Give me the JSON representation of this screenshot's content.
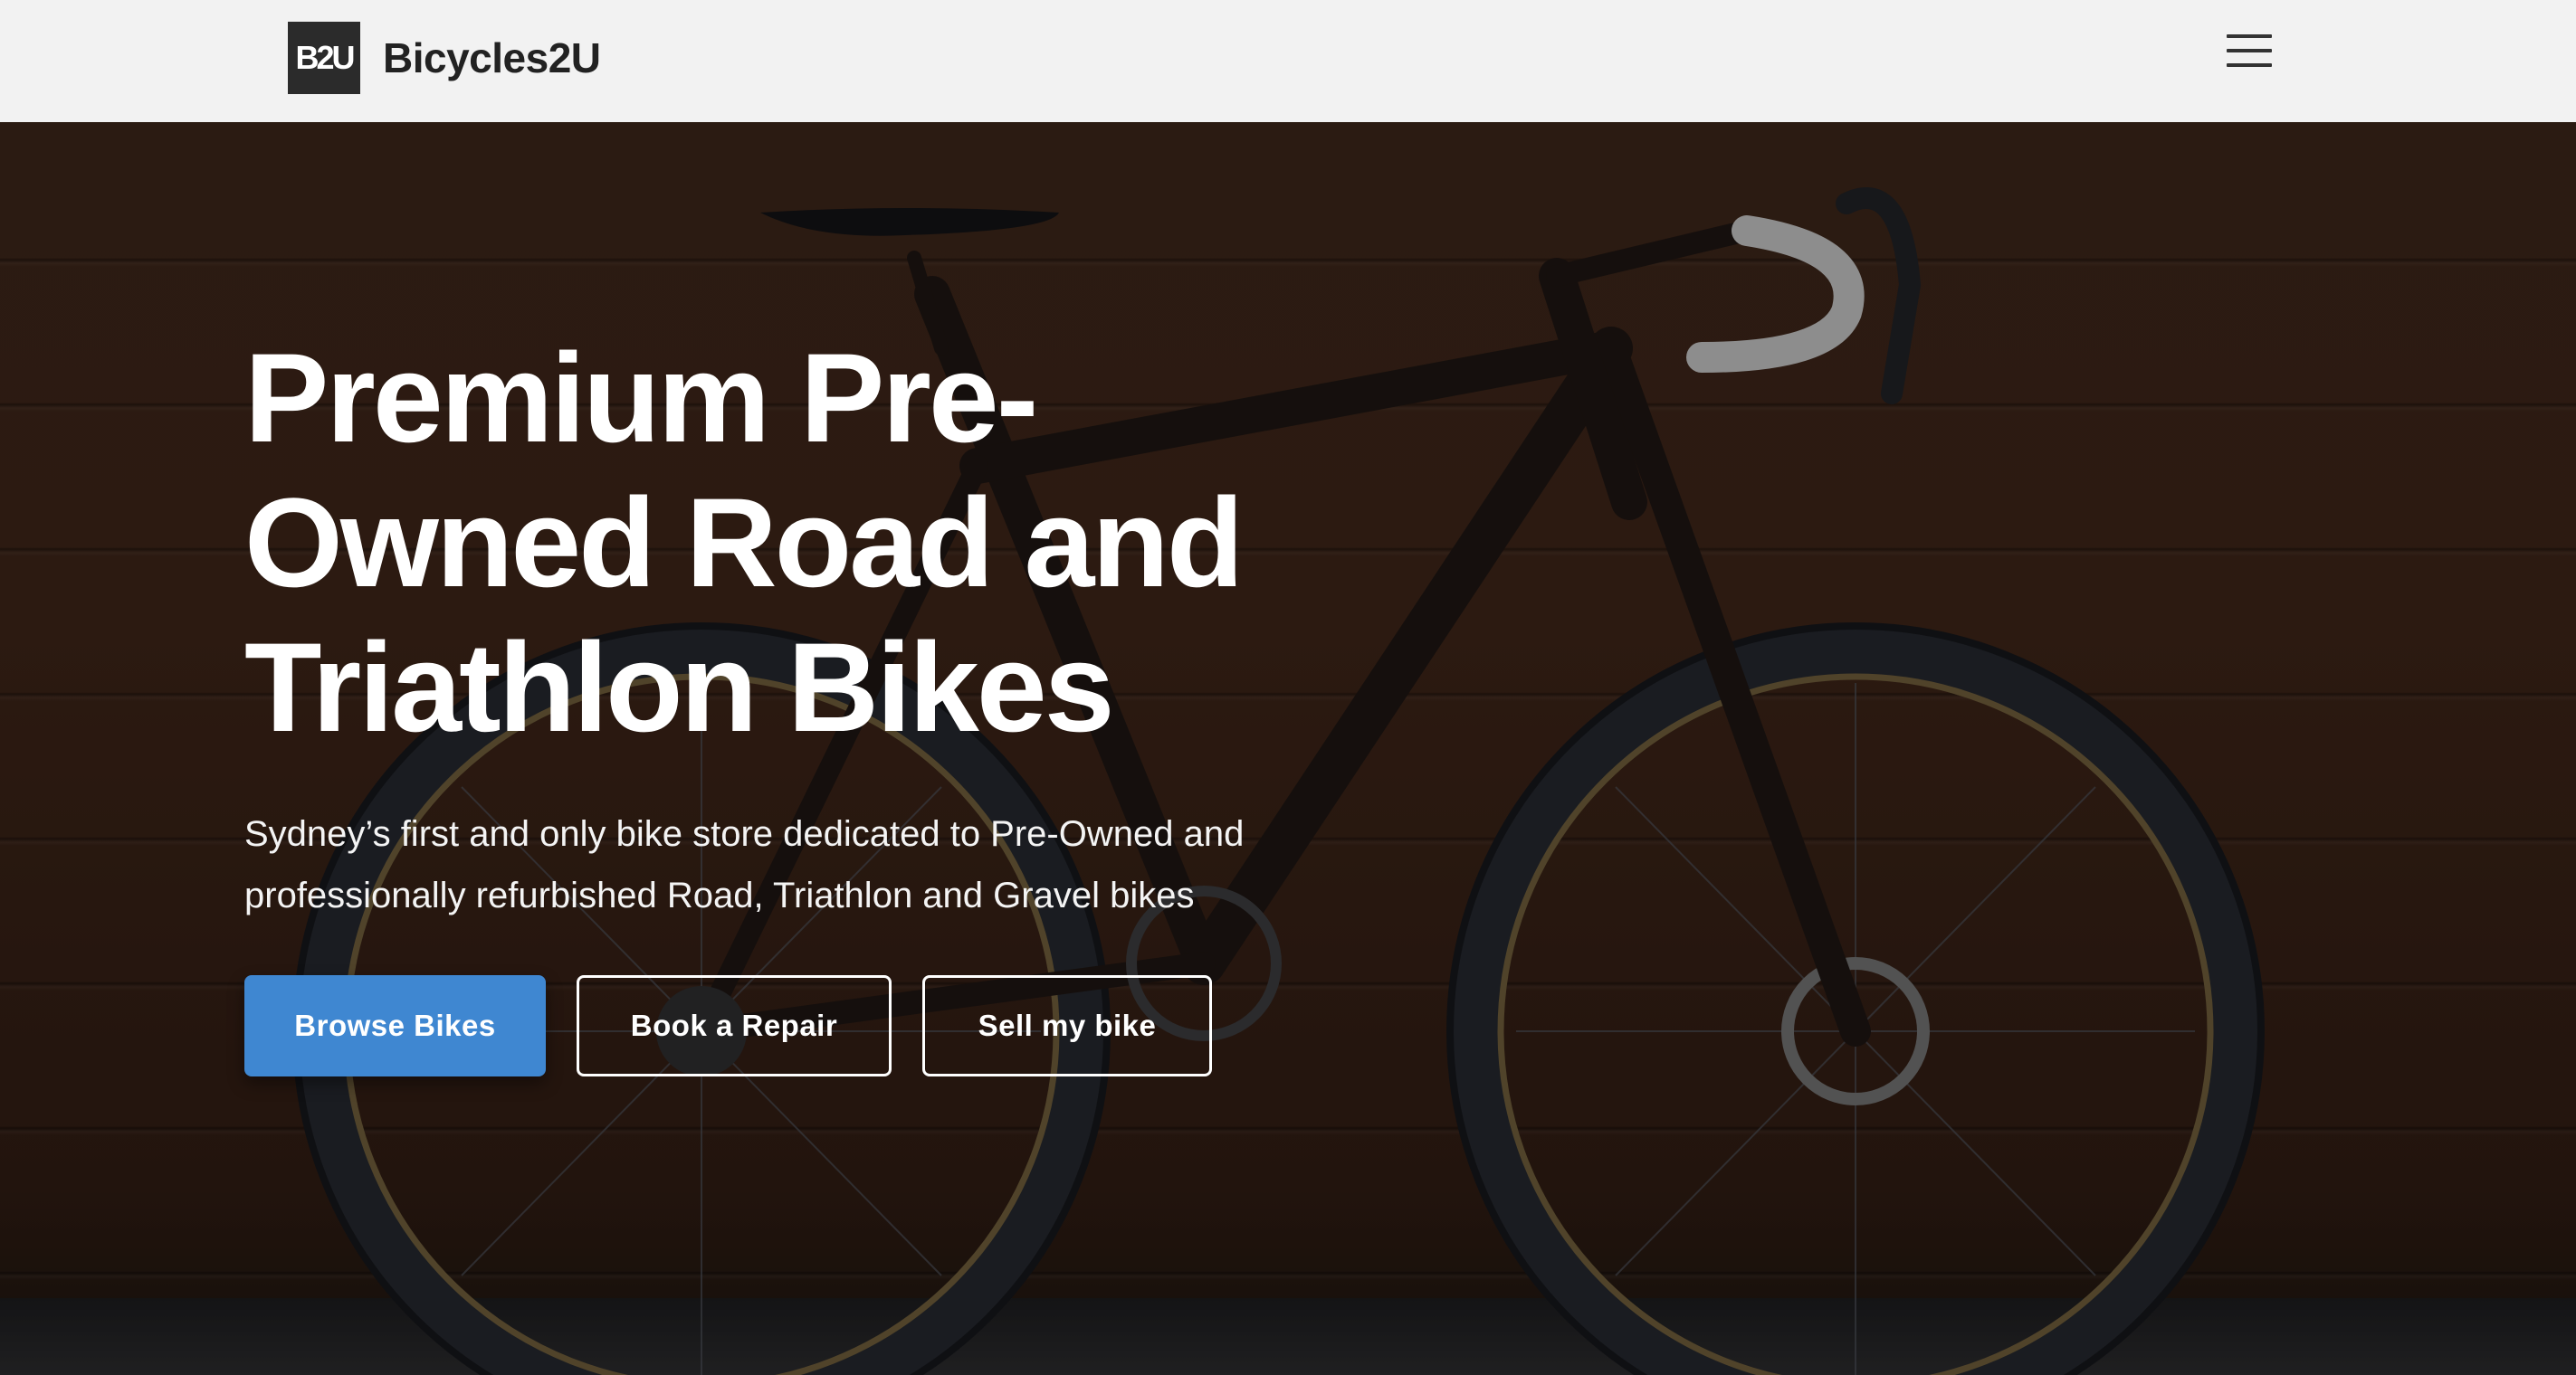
{
  "header": {
    "logo_mark": "B2U",
    "brand_name": "Bicycles2U",
    "menu_icon": "hamburger-menu-icon"
  },
  "hero": {
    "title": "Premium Pre-Owned Road and Triathlon Bikes",
    "subtitle": "Sydney’s first and only bike store dedicated to Pre-Owned and professionally refurbished Road, Triathlon and Gravel bikes",
    "buttons": {
      "browse": "Browse Bikes",
      "repair": "Book a Repair",
      "sell": "Sell my bike"
    }
  },
  "colors": {
    "header_bg": "#f2f2f2",
    "primary_button": "#3f87d1",
    "hero_wall": "#3a2418",
    "text_light": "#ffffff"
  }
}
